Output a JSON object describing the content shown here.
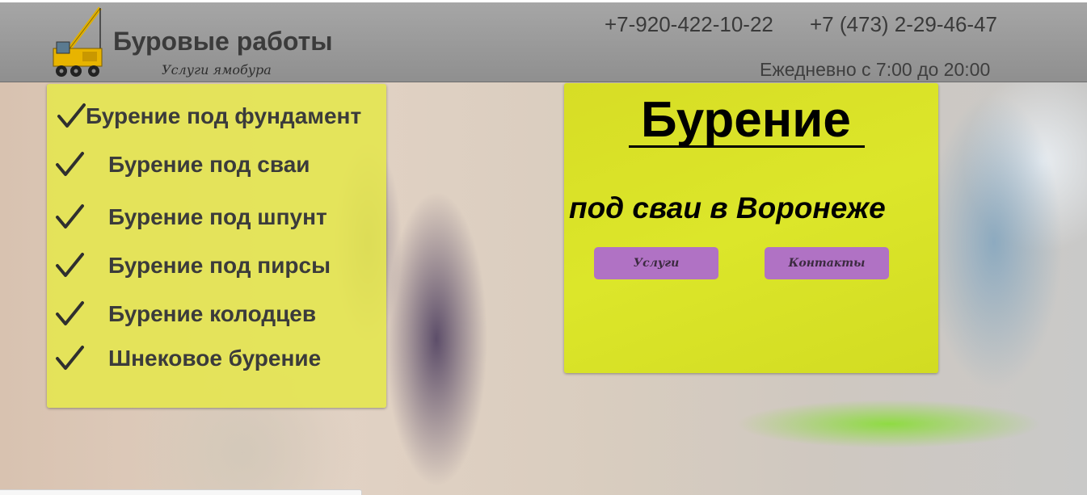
{
  "header": {
    "title": "Буровые работы",
    "subtitle": "Услуги ямобура",
    "phone_1": "+7-920-422-10-22",
    "phone_2": "+7 (473) 2-29-46-47",
    "hours": "Ежедневно с 7:00 до 20:00",
    "logo_icon": "crane-icon"
  },
  "services": {
    "check_icon": "check-icon",
    "items": [
      {
        "label": "Бурение под фундамент"
      },
      {
        "label": "Бурение под сваи"
      },
      {
        "label": "Бурение под шпунт"
      },
      {
        "label": "Бурение под пирсы"
      },
      {
        "label": "Бурение колодцев"
      },
      {
        "label": "Шнековое бурение"
      }
    ]
  },
  "hero": {
    "title": "Бурение",
    "subtitle": "под сваи в Воронеже",
    "buttons": {
      "services": "Услуги",
      "contacts": "Контакты"
    }
  },
  "colors": {
    "header_bg": "#9a9a9a",
    "panel_yellow": "#dce62a",
    "button_purple": "#b072c4"
  }
}
